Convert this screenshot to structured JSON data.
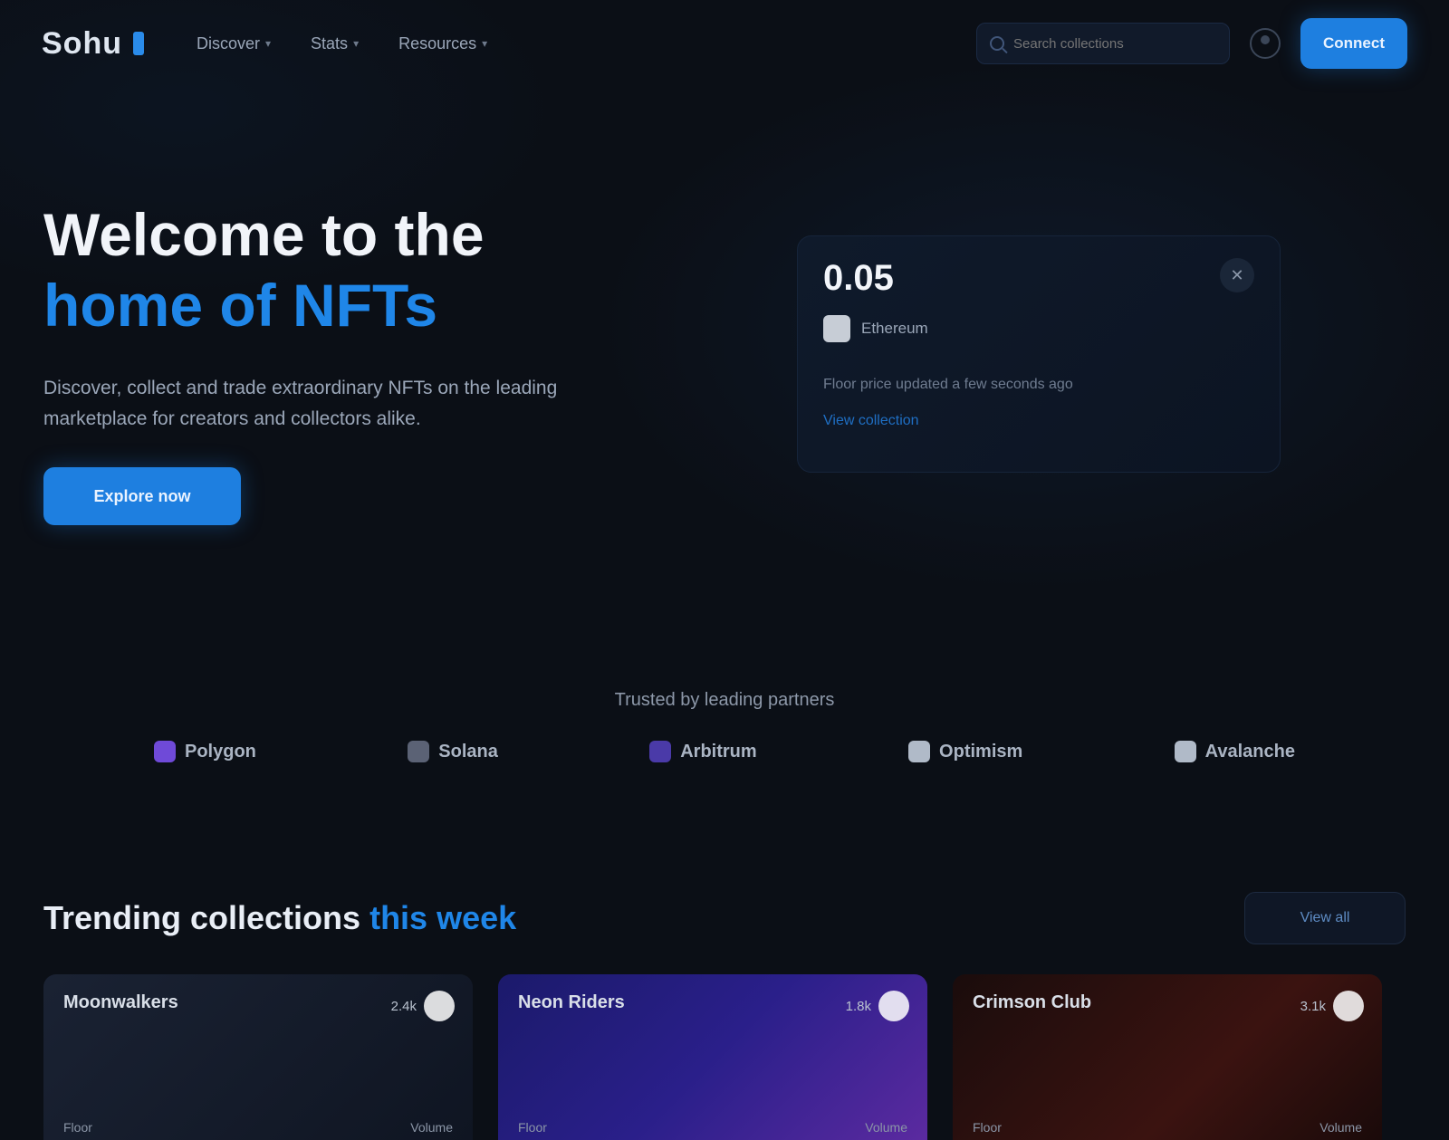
{
  "nav": {
    "logo": "Sohu",
    "links": [
      {
        "label": "Discover"
      },
      {
        "label": "Stats"
      },
      {
        "label": "Resources"
      }
    ],
    "search_placeholder": "Search collections",
    "primary_label": "Connect"
  },
  "hero": {
    "title_line1": "Welcome to the",
    "title_line2": "home of NFTs",
    "subtitle": "Discover, collect and trade extraordinary NFTs on the leading marketplace for creators and collectors alike.",
    "cta_label": "Explore now"
  },
  "card": {
    "price": "0.05",
    "close_glyph": "✕",
    "token_name": "Ethereum",
    "description": "Floor price updated a few seconds ago",
    "link": "View collection"
  },
  "partners": {
    "title": "Trusted by leading partners",
    "items": [
      {
        "name": "Polygon",
        "color": "#6f4ad8"
      },
      {
        "name": "Solana",
        "color": "#5b6275"
      },
      {
        "name": "Arbitrum",
        "color": "#4a3aa8"
      },
      {
        "name": "Optimism",
        "color": "#b0bac8"
      },
      {
        "name": "Avalanche",
        "color": "#b0bac8"
      }
    ]
  },
  "trending": {
    "title_plain": "Trending collections",
    "title_accent": "this week",
    "view_all": "View all",
    "cards": [
      {
        "name": "Moonwalkers",
        "likes": "2.4k",
        "bg": "linear-gradient(135deg,#1a2233,#0f1522)",
        "floor": "Floor",
        "volume": "Volume"
      },
      {
        "name": "Neon Riders",
        "likes": "1.8k",
        "bg": "linear-gradient(135deg,#1b1a6b,#2a1f8a 50%,#5b2aa0)",
        "floor": "Floor",
        "volume": "Volume"
      },
      {
        "name": "Crimson Club",
        "likes": "3.1k",
        "bg": "linear-gradient(135deg,#1a0c0c,#3b1310 60%,#1a0a0a)",
        "floor": "Floor",
        "volume": "Volume"
      }
    ]
  }
}
